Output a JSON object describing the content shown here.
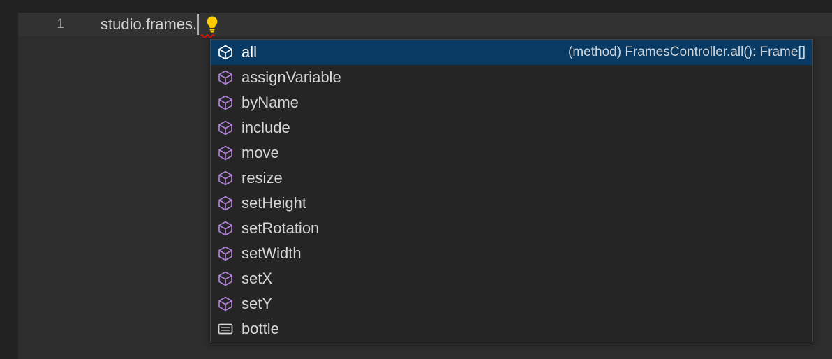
{
  "editor": {
    "line_number": "1",
    "code_text": "studio.frames.",
    "caret": "text-cursor",
    "lightbulb_icon": "lightbulb-icon",
    "error_marker": "red-squiggle-underline",
    "colors": {
      "background": "#2d2d2d",
      "current_line": "#323232",
      "gutter": "#212121",
      "code_foreground": "#d4d4d4",
      "line_number_foreground": "#a0a0a0",
      "lightbulb": "#ffcc00",
      "squiggle": "#e51400"
    }
  },
  "suggest": {
    "focused_index": 0,
    "colors": {
      "background": "#252526",
      "border": "#454545",
      "selected_background": "#093a63",
      "method_icon": "#b180d7",
      "method_icon_selected": "#ffffff",
      "text_icon": "#d6d6d6",
      "label": "#d6d6d6",
      "detail": "#cfd6dc"
    },
    "items": [
      {
        "label": "all",
        "icon": "method-cube-icon",
        "kind": "method",
        "detail": "(method) FramesController.all(): Frame[]"
      },
      {
        "label": "assignVariable",
        "icon": "method-cube-icon",
        "kind": "method",
        "detail": ""
      },
      {
        "label": "byName",
        "icon": "method-cube-icon",
        "kind": "method",
        "detail": ""
      },
      {
        "label": "include",
        "icon": "method-cube-icon",
        "kind": "method",
        "detail": ""
      },
      {
        "label": "move",
        "icon": "method-cube-icon",
        "kind": "method",
        "detail": ""
      },
      {
        "label": "resize",
        "icon": "method-cube-icon",
        "kind": "method",
        "detail": ""
      },
      {
        "label": "setHeight",
        "icon": "method-cube-icon",
        "kind": "method",
        "detail": ""
      },
      {
        "label": "setRotation",
        "icon": "method-cube-icon",
        "kind": "method",
        "detail": ""
      },
      {
        "label": "setWidth",
        "icon": "method-cube-icon",
        "kind": "method",
        "detail": ""
      },
      {
        "label": "setX",
        "icon": "method-cube-icon",
        "kind": "method",
        "detail": ""
      },
      {
        "label": "setY",
        "icon": "method-cube-icon",
        "kind": "method",
        "detail": ""
      },
      {
        "label": "bottle",
        "icon": "text-lines-icon",
        "kind": "text",
        "detail": ""
      }
    ]
  }
}
